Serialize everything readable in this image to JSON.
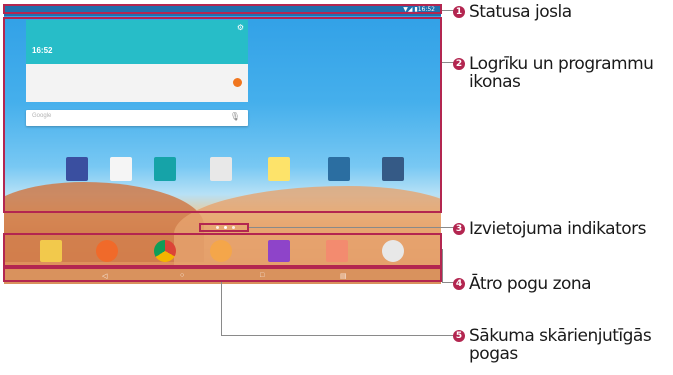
{
  "screen": {
    "time": "16:52",
    "search_placeholder": "Google",
    "status_icons": "▼◢ ▮16:52"
  },
  "callouts": [
    {
      "number": "1",
      "label": "Statusa josla"
    },
    {
      "number": "2",
      "label": "Logrīku un programmu ikonas"
    },
    {
      "number": "3",
      "label": "Izvietojuma indikators"
    },
    {
      "number": "4",
      "label": "Ātro pogu zona"
    },
    {
      "number": "5",
      "label": "Sākuma skārienjutīgās pogas"
    }
  ],
  "colors": {
    "accent": "#b32650",
    "widget": "#27bdc8"
  }
}
